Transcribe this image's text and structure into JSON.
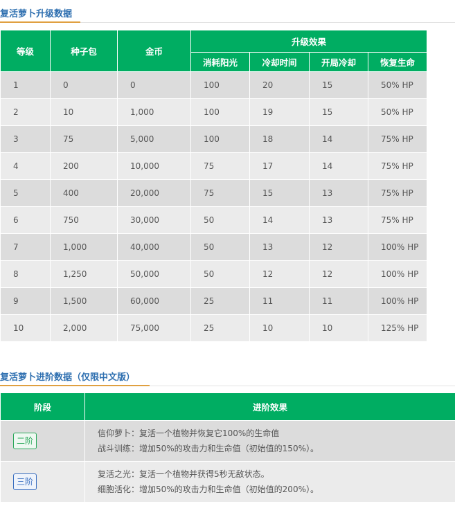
{
  "upgrade_section": {
    "title": "复活萝卜升级数据",
    "headers": {
      "level": "等级",
      "seed": "种子包",
      "gold": "金币",
      "effect_group": "升级效果",
      "sun": "消耗阳光",
      "cooldown": "冷却时间",
      "start_cd": "开局冷却",
      "heal": "恢复生命"
    },
    "rows": [
      {
        "level": "1",
        "seed": "0",
        "gold": "0",
        "sun": "100",
        "cooldown": "20",
        "start_cd": "15",
        "heal": "50% HP"
      },
      {
        "level": "2",
        "seed": "10",
        "gold": "1,000",
        "sun": "100",
        "cooldown": "19",
        "start_cd": "15",
        "heal": "50% HP"
      },
      {
        "level": "3",
        "seed": "75",
        "gold": "5,000",
        "sun": "100",
        "cooldown": "18",
        "start_cd": "14",
        "heal": "75% HP"
      },
      {
        "level": "4",
        "seed": "200",
        "gold": "10,000",
        "sun": "75",
        "cooldown": "17",
        "start_cd": "14",
        "heal": "75% HP"
      },
      {
        "level": "5",
        "seed": "400",
        "gold": "20,000",
        "sun": "75",
        "cooldown": "15",
        "start_cd": "13",
        "heal": "75% HP"
      },
      {
        "level": "6",
        "seed": "750",
        "gold": "30,000",
        "sun": "50",
        "cooldown": "14",
        "start_cd": "13",
        "heal": "75% HP"
      },
      {
        "level": "7",
        "seed": "1,000",
        "gold": "40,000",
        "sun": "50",
        "cooldown": "13",
        "start_cd": "12",
        "heal": "100% HP"
      },
      {
        "level": "8",
        "seed": "1,250",
        "gold": "50,000",
        "sun": "50",
        "cooldown": "12",
        "start_cd": "12",
        "heal": "100% HP"
      },
      {
        "level": "9",
        "seed": "1,500",
        "gold": "60,000",
        "sun": "25",
        "cooldown": "11",
        "start_cd": "11",
        "heal": "100% HP"
      },
      {
        "level": "10",
        "seed": "2,000",
        "gold": "75,000",
        "sun": "25",
        "cooldown": "10",
        "start_cd": "10",
        "heal": "125% HP"
      }
    ]
  },
  "advance_section": {
    "title": "复活萝卜进阶数据（仅限中文版）",
    "headers": {
      "stage": "阶段",
      "effect": "进阶效果"
    },
    "rows": [
      {
        "stage": "二阶",
        "badge_color": "#2aa85a",
        "line1": "信仰萝卜：复活一个植物并恢复它100%的生命值",
        "line2": "战斗训练：增加50%的攻击力和生命值（初始值的150%）。"
      },
      {
        "stage": "三阶",
        "badge_color": "#3a6fc0",
        "line1": "复活之光：复活一个植物并获得5秒无敌状态。",
        "line2": "细胞活化：增加50%的攻击力和生命值（初始值的200%）。"
      }
    ]
  },
  "colors": {
    "header_green": "#00ad62",
    "title_blue": "#2e6fb0",
    "accent_orange": "#e0a040"
  }
}
